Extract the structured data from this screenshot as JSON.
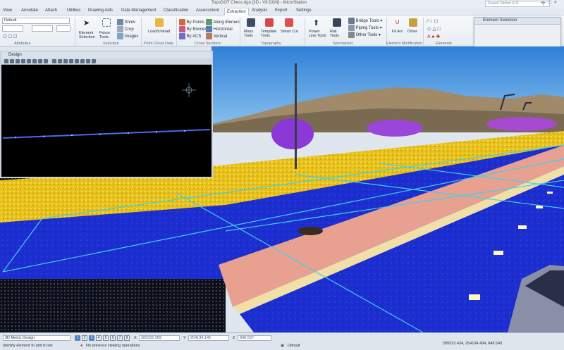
{
  "window": {
    "title": "TopoDOT Chess.dgn [3D - V8 DGN] - MicroStation",
    "search_placeholder": "Search Ribbon (F4)"
  },
  "tabs": [
    "View",
    "Annotate",
    "Attach",
    "Utilities",
    "Drawing Aids",
    "Data Management",
    "Classification",
    "Assessment",
    "Extraction",
    "Analysis",
    "Export",
    "Settings"
  ],
  "active_tab": "Extraction",
  "ribbon": {
    "attributes": {
      "combo1": "Default",
      "group_label": "Attributes"
    },
    "selection": {
      "element_selection": "Element Selection",
      "fence_tools": "Fence Tools",
      "show": "Show",
      "crop": "Crop",
      "images": "Images",
      "group_label": "Selection"
    },
    "point_cloud": {
      "load_unload": "Load/Unload",
      "group_label": "Point Cloud Data"
    },
    "cross_sections": {
      "by_points": "By Points",
      "by_element": "By Element",
      "by_acs": "By ACS",
      "along_element": "Along Element",
      "horizontal": "Horizontal",
      "vertical": "Vertical",
      "group_label": "Cross Sections"
    },
    "topography": {
      "mass_tools": "Mass Tools",
      "template_tools": "Template Tools",
      "smart_cut": "Smart Cut",
      "group_label": "Topography"
    },
    "specialized": {
      "power_line_tools": "Power Line Tools",
      "rail_tools": "Rail Tools",
      "bridge_tools": "Bridge Tools",
      "piping_tools": "Piping Tools",
      "other_tools": "Other Tools",
      "group_label": "Specialized"
    },
    "element_modification": {
      "fit_arc": "Fit Arc",
      "other": "Other",
      "group_label": "Element Modification"
    },
    "elements": {
      "group_label": "Elements"
    }
  },
  "element_selection_panel": {
    "title": "Element Selection"
  },
  "design_view": {
    "title": "Design"
  },
  "status": {
    "model": "3D Metric Design",
    "view_buttons": [
      "1",
      "2",
      "3",
      "4",
      "5",
      "6",
      "7",
      "8"
    ],
    "x_label": "X",
    "x_value": "289322.989",
    "y_label": "Y",
    "y_value": "254194.145",
    "z_label": "Z",
    "z_value": "848.537",
    "prompt": "Identify element to add to set",
    "message": "No previous viewing operations",
    "level": "Default",
    "coords": "289322.434, 254194.494, 848.540"
  },
  "colors": {
    "road": "#1d2fd0",
    "vegetation": "#f0d020",
    "trees": "#8a3ad8",
    "sky": "#3d8ee0",
    "selection_line": "#3fd0e8",
    "sidewalk": "#f08878"
  }
}
